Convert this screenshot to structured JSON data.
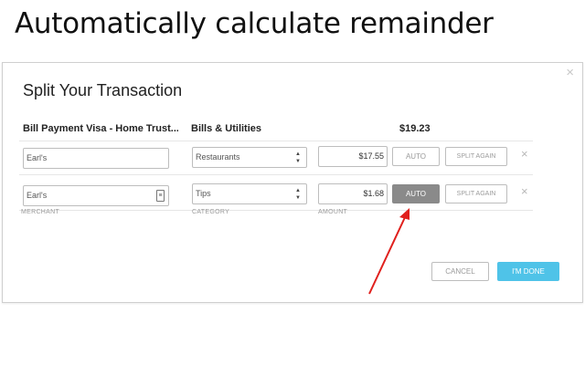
{
  "slide": {
    "title": "Automatically calculate remainder"
  },
  "modal": {
    "title": "Split Your Transaction",
    "close_icon": "×",
    "summary": {
      "merchant": "Bill Payment Visa - Home Trust...",
      "category": "Bills & Utilities",
      "total": "$19.23"
    },
    "rows": [
      {
        "merchant": "Earl's",
        "category": "Restaurants",
        "amount": "$17.55",
        "auto_label": "AUTO",
        "auto_active": false,
        "split_label": "SPLIT AGAIN"
      },
      {
        "merchant": "Earl's",
        "category": "Tips",
        "amount": "$1.68",
        "auto_label": "AUTO",
        "auto_active": true,
        "split_label": "SPLIT AGAIN"
      }
    ],
    "column_labels": {
      "merchant": "MERCHANT",
      "category": "CATEGORY",
      "amount": "AMOUNT"
    },
    "buttons": {
      "cancel": "CANCEL",
      "done": "I'M DONE"
    },
    "remove_icon": "×"
  },
  "colors": {
    "done": "#4fc3e8",
    "auto_active": "#8a8a8a",
    "annotation_arrow": "#e0201d"
  },
  "icons": {
    "select": "updown-arrow-icon",
    "contact": "contact-card-icon",
    "close": "close-icon"
  }
}
